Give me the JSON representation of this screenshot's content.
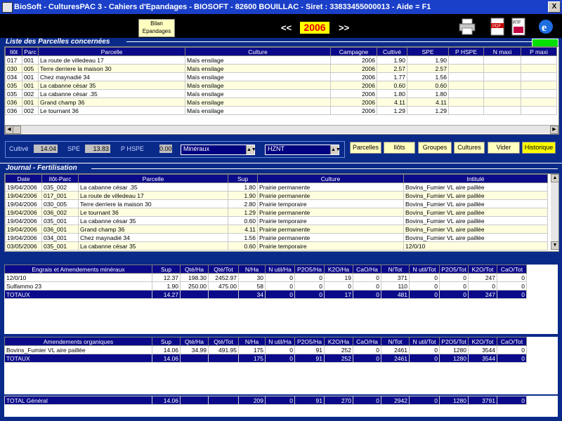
{
  "window": {
    "title": "BioSoft - CulturesPAC 3 - Cahiers d'Epandages  -  BIOSOFT - 82600 BOUILLAC - Siret : 33833455000013 - Aide = F1",
    "close": "X"
  },
  "toolbar": {
    "bilan_line1": "Bilan",
    "bilan_line2": "Epandages",
    "prev": "<<",
    "year": "2006",
    "next": ">>"
  },
  "parcelles": {
    "title": "Liste des Parcelles concernées",
    "columns": [
      "Ilôt",
      "Parc",
      "Parcelle",
      "Culture",
      "Campagne",
      "Cultivé",
      "SPE",
      "P HSPE",
      "N maxi",
      "P maxi"
    ],
    "rows": [
      [
        "017",
        "001",
        "La route de villedeau 17",
        "Maïs ensilage",
        "2006",
        "1.90",
        "1.90",
        "",
        "",
        ""
      ],
      [
        "030",
        "005",
        "Terre derriere la maison 30",
        "Maïs ensilage",
        "2006",
        "2.57",
        "2.57",
        "",
        "",
        ""
      ],
      [
        "034",
        "001",
        "Chez maynadié 34",
        "Maïs ensilage",
        "2006",
        "1.77",
        "1.56",
        "",
        "",
        ""
      ],
      [
        "035",
        "001",
        "La cabanne césar 35",
        "Maïs ensilage",
        "2006",
        "0.60",
        "0.60",
        "",
        "",
        ""
      ],
      [
        "035",
        "002",
        "La cabanne césar .35",
        "Maïs ensilage",
        "2006",
        "1.80",
        "1.80",
        "",
        "",
        ""
      ],
      [
        "036",
        "001",
        "Grand champ 36",
        "Maïs ensilage",
        "2006",
        "4.11",
        "4.11",
        "",
        "",
        ""
      ],
      [
        "036",
        "002",
        "Le tournant 36",
        "Maïs ensilage",
        "2006",
        "1.29",
        "1.29",
        "",
        "",
        ""
      ]
    ]
  },
  "summary": {
    "cultive_label": "Cultivé",
    "cultive_val": "14.04",
    "spe_label": "SPE",
    "spe_val": "13.83",
    "phspe_label": "P HSPE",
    "phspe_val": "0.00",
    "combo1": "Minéraux",
    "combo2": "HZNT"
  },
  "buttons": {
    "parcelles": "Parcelles",
    "ilots": "Ilôts",
    "groupes": "Groupes",
    "cultures": "Cultures",
    "vider": "Vider",
    "historique": "Historique"
  },
  "journal": {
    "title": "Journal - Fertilisation",
    "columns": [
      "Date",
      "Ilôt-Parc",
      "Parcelle",
      "Sup",
      "Culture",
      "Intitulé"
    ],
    "rows": [
      [
        "19/04/2006",
        "035_002",
        "La cabanne césar .35",
        "1.80",
        "Prairie permanente",
        "Bovins_Fumier VL aire paillée"
      ],
      [
        "19/04/2006",
        "017_001",
        "La route de villedeau 17",
        "1.90",
        "Prairie permanente",
        "Bovins_Fumier VL aire paillée"
      ],
      [
        "19/04/2006",
        "030_005",
        "Terre derriere la maison 30",
        "2.80",
        "Prairie temporaire",
        "Bovins_Fumier VL aire paillée"
      ],
      [
        "19/04/2006",
        "036_002",
        "Le tournant 36",
        "1.29",
        "Prairie permanente",
        "Bovins_Fumier VL aire paillée"
      ],
      [
        "19/04/2006",
        "035_001",
        "La cabanne césar 35",
        "0.60",
        "Prairie temporaire",
        "Bovins_Fumier VL aire paillée"
      ],
      [
        "19/04/2006",
        "036_001",
        "Grand champ 36",
        "4.11",
        "Prairie permanente",
        "Bovins_Fumier VL aire paillée"
      ],
      [
        "19/04/2006",
        "034_001",
        "Chez maynadié 34",
        "1.56",
        "Prairie permanente",
        "Bovins_Fumier VL aire paillée"
      ],
      [
        "03/05/2006",
        "035_001",
        "La cabanne césar 35",
        "0.60",
        "Prairie temporaire",
        "12/0/10"
      ]
    ]
  },
  "mineraux": {
    "columns": [
      "Engrais et Amendements minéraux",
      "Sup",
      "Qté/Ha",
      "Qté/Tot",
      "N/Ha",
      "N util/Ha",
      "P2O5/Ha",
      "K2O/Ha",
      "CaO/Ha",
      "N/Tot",
      "N util/Tot",
      "P2O5/Tot",
      "K2O/Tot",
      "CaO/Tot"
    ],
    "rows": [
      [
        "12/0/10",
        "12.37",
        "198.30",
        "2452.97",
        "30",
        "0",
        "0",
        "19",
        "0",
        "371",
        "0",
        "0",
        "247",
        "0"
      ],
      [
        "Sulfammo 23",
        "1.90",
        "250.00",
        "475.00",
        "58",
        "0",
        "0",
        "0",
        "0",
        "110",
        "0",
        "0",
        "0",
        "0"
      ]
    ],
    "total": [
      "TOTAUX",
      "14.27",
      "",
      "",
      "34",
      "0",
      "0",
      "17",
      "0",
      "481",
      "0",
      "0",
      "247",
      "0"
    ]
  },
  "organiques": {
    "columns": [
      "Amendements organiques",
      "Sup",
      "Qté/Ha",
      "Qté/Tot",
      "N/Ha",
      "N util/Ha",
      "P2O5/Ha",
      "K2O/Ha",
      "CaO/Ha",
      "N/Tot",
      "N util/Tot",
      "P2O5/Tot",
      "K2O/Tot",
      "CaO/Tot"
    ],
    "rows": [
      [
        "Bovins_Fumier VL aire paillée",
        "14.06",
        "34.99",
        "491.95",
        "175",
        "0",
        "91",
        "252",
        "0",
        "2461",
        "0",
        "1280",
        "3544",
        "0"
      ]
    ],
    "total": [
      "TOTAUX",
      "14.06",
      "",
      "",
      "175",
      "0",
      "91",
      "252",
      "0",
      "2461",
      "0",
      "1280",
      "3544",
      "0"
    ]
  },
  "general": [
    "TOTAL Général",
    "14.06",
    "",
    "",
    "209",
    "0",
    "91",
    "270",
    "0",
    "2942",
    "0",
    "1280",
    "3791",
    "0"
  ],
  "icons": {
    "printer": "printer-icon",
    "pdf": "pdf-icon",
    "rtf": "rtf-icon",
    "ie": "internet-explorer-icon"
  }
}
